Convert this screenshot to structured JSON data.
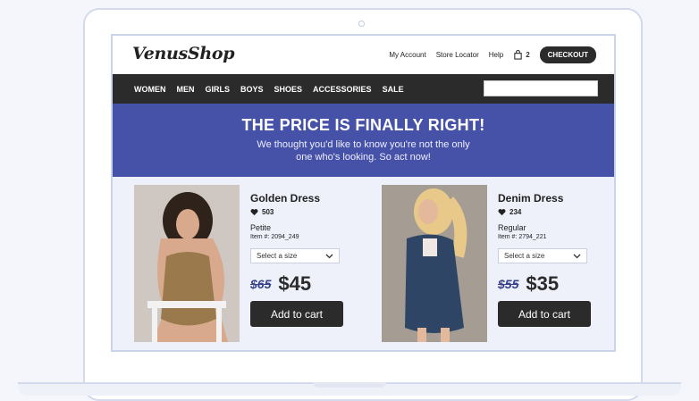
{
  "brand": {
    "logo": "VenusShop"
  },
  "header": {
    "links": [
      "My Account",
      "Store Locator",
      "Help"
    ],
    "cart_count": "2",
    "checkout_label": "CHECKOUT"
  },
  "nav": {
    "items": [
      "WOMEN",
      "MEN",
      "GIRLS",
      "BOYS",
      "SHOES",
      "ACCESSORIES",
      "SALE"
    ],
    "search_placeholder": ""
  },
  "banner": {
    "title": "THE PRICE IS FINALLY RIGHT!",
    "text": "We thought you'd like to know you're not the only one who's looking. So act now!"
  },
  "products": [
    {
      "name": "Golden Dress",
      "likes": "503",
      "fit": "Petite",
      "item": "Item #: 2094_249",
      "size_select": "Select a size",
      "old_price": "$65",
      "price": "$45",
      "add_label": "Add to cart"
    },
    {
      "name": "Denim Dress",
      "likes": "234",
      "fit": "Regular",
      "item": "Item #: 2794_221",
      "size_select": "Select a size",
      "old_price": "$55",
      "price": "$35",
      "add_label": "Add to cart"
    }
  ],
  "colors": {
    "nav_bg": "#2b2b2b",
    "banner_bg": "#4652a8",
    "products_bg": "#eef1fa",
    "old_price": "#39418a"
  }
}
